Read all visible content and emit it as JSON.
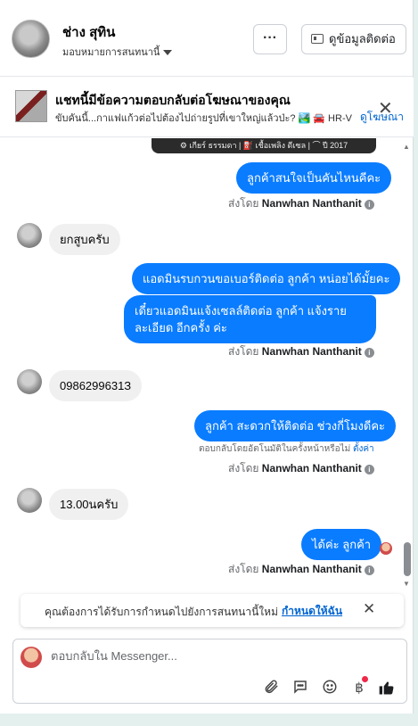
{
  "header": {
    "name": "ช่าง สุทิน",
    "subtitle": "มอบหมายการสนทนานี้",
    "more_label": "···",
    "contact_label": "ดูข้อมูลติดต่อ"
  },
  "ad_banner": {
    "title": "แชทนี้มีข้อความตอบกลับต่อโฆษณาของคุณ",
    "text": "ขับคันนี้...กาแฟแก้วต่อไปต้องไปถ่ายรูปที่เขาใหญ่แล้วป่ะ? 🏞️ 🚘 HR-V 1....",
    "link": "ดูโฆษณา",
    "close": "✕"
  },
  "car_strip": "⚙ เกียร์ ธรรมดา  |  ⛽ เชื้อเพลิง ดีเซล  |  ⌒ ปี 2017",
  "messages": [
    {
      "text": "ลูกค้าสนใจเป็นคันไหนคีคะ"
    },
    {
      "text": "ยกสูบครับ"
    },
    {
      "text": "แอดมินรบกวนขอเบอร์ติดต่อ ลูกค้า หน่อยได้มั้ยคะ"
    },
    {
      "text": "เดี๋ยวแอดมินแจ้งเซลล์ติดต่อ ลูกค้า แจ้งรายละเอียด อีกครั้ง ค่ะ"
    },
    {
      "text": "0986299631З"
    },
    {
      "text": "ลูกค้า สะดวกให้ติดต่อ ช่วงกี่โมงดีคะ"
    },
    {
      "text": "13.00นครับ"
    },
    {
      "text": "ได้ค่ะ ลูกค้า"
    }
  ],
  "sent_by": {
    "prefix": "ส่งโดย",
    "name": "Nanwhan Nanthanit",
    "info_icon": "i"
  },
  "auto_note": {
    "text": "ตอบกลับโดยอัตโนมัติในครั้งหน้าหรือไม่",
    "link": "ตั้งค่า"
  },
  "reminder": {
    "text": "คุณต้องการได้รับการกำหนดไปยังการสนทนานี้ใหม่",
    "link": "กำหนดให้ฉัน",
    "close": "✕"
  },
  "reply": {
    "placeholder": "ตอบกลับใน Messenger..."
  },
  "icons": {
    "attach": "paperclip-icon",
    "saved_replies": "chat-bubble-icon",
    "emoji": "emoji-icon",
    "payment": "baht-icon",
    "like": "thumbs-up-icon"
  },
  "colors": {
    "outgoing_bubble": "#0a7cff",
    "incoming_bubble": "#f0f0f0",
    "link": "#0064d1"
  }
}
